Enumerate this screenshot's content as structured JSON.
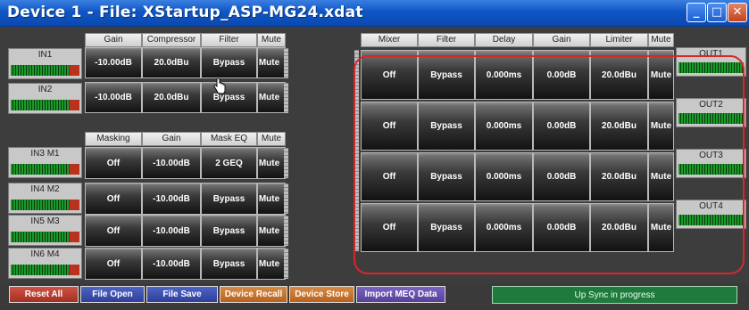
{
  "window": {
    "title": "Device 1  -  File: XStartup_ASP-MG24.xdat"
  },
  "input_section": {
    "headers": [
      "Gain",
      "Compressor",
      "Filter",
      "Mute"
    ],
    "channels": [
      {
        "label": "IN1",
        "gain": "-10.00dB",
        "compressor": "20.0dBu",
        "filter": "Bypass",
        "mute": "Mute"
      },
      {
        "label": "IN2",
        "gain": "-10.00dB",
        "compressor": "20.0dBu",
        "filter": "Bypass",
        "mute": "Mute"
      }
    ]
  },
  "mic_section": {
    "headers": [
      "Masking",
      "Gain",
      "Mask EQ",
      "Mute"
    ],
    "channels": [
      {
        "label": "IN3 M1",
        "masking": "Off",
        "gain": "-10.00dB",
        "mask_eq": "2 GEQ",
        "mute": "Mute"
      },
      {
        "label": "IN4 M2",
        "masking": "Off",
        "gain": "-10.00dB",
        "mask_eq": "Bypass",
        "mute": "Mute"
      },
      {
        "label": "IN5 M3",
        "masking": "Off",
        "gain": "-10.00dB",
        "mask_eq": "Bypass",
        "mute": "Mute"
      },
      {
        "label": "IN6 M4",
        "masking": "Off",
        "gain": "-10.00dB",
        "mask_eq": "Bypass",
        "mute": "Mute"
      }
    ]
  },
  "output_section": {
    "headers": [
      "Mixer",
      "Filter",
      "Delay",
      "Gain",
      "Limiter",
      "Mute"
    ],
    "channels": [
      {
        "label": "OUT1",
        "mixer": "Off",
        "filter": "Bypass",
        "delay": "0.000ms",
        "gain": "0.00dB",
        "limiter": "20.0dBu",
        "mute": "Mute"
      },
      {
        "label": "OUT2",
        "mixer": "Off",
        "filter": "Bypass",
        "delay": "0.000ms",
        "gain": "0.00dB",
        "limiter": "20.0dBu",
        "mute": "Mute"
      },
      {
        "label": "OUT3",
        "mixer": "Off",
        "filter": "Bypass",
        "delay": "0.000ms",
        "gain": "0.00dB",
        "limiter": "20.0dBu",
        "mute": "Mute"
      },
      {
        "label": "OUT4",
        "mixer": "Off",
        "filter": "Bypass",
        "delay": "0.000ms",
        "gain": "0.00dB",
        "limiter": "20.0dBu",
        "mute": "Mute"
      }
    ]
  },
  "footer": {
    "reset_all": "Reset All",
    "file_open": "File Open",
    "file_save": "File Save",
    "device_recall": "Device Recall",
    "device_store": "Device Store",
    "import_meq": "Import MEQ Data",
    "status": "Up Sync in progress"
  },
  "colors": {
    "titlebar": "#0f56c6",
    "reset_button": "#b83a2e",
    "file_buttons": "#3a4fb0",
    "device_buttons": "#c8752a",
    "import_button": "#5f4aa6",
    "sync_bar": "#1f7a3e",
    "highlight_frame": "#d8262d"
  },
  "icons": {
    "window_controls": [
      "minimize-icon",
      "maximize-icon",
      "close-icon"
    ],
    "pointer": "hand-cursor-icon"
  }
}
